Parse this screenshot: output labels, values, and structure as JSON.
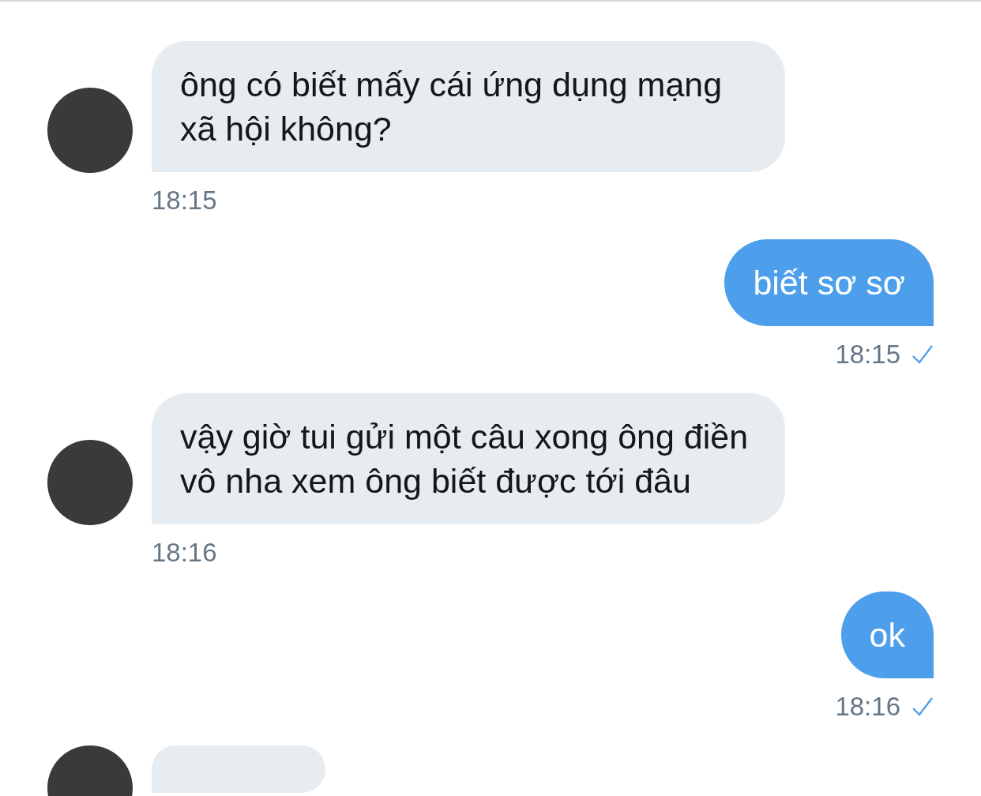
{
  "messages": [
    {
      "kind": "incoming",
      "text": "ông có biết mấy cái ứng dụng mạng xã hội không?",
      "time": "18:15"
    },
    {
      "kind": "outgoing",
      "text": "biết sơ sơ",
      "time": "18:15",
      "read": true
    },
    {
      "kind": "incoming",
      "text": "vậy giờ tui gửi một câu xong ông điền vô nha xem ông biết được tới đâu",
      "time": "18:16"
    },
    {
      "kind": "outgoing",
      "text": "ok",
      "time": "18:16",
      "read": true
    },
    {
      "kind": "incoming-partial"
    }
  ]
}
